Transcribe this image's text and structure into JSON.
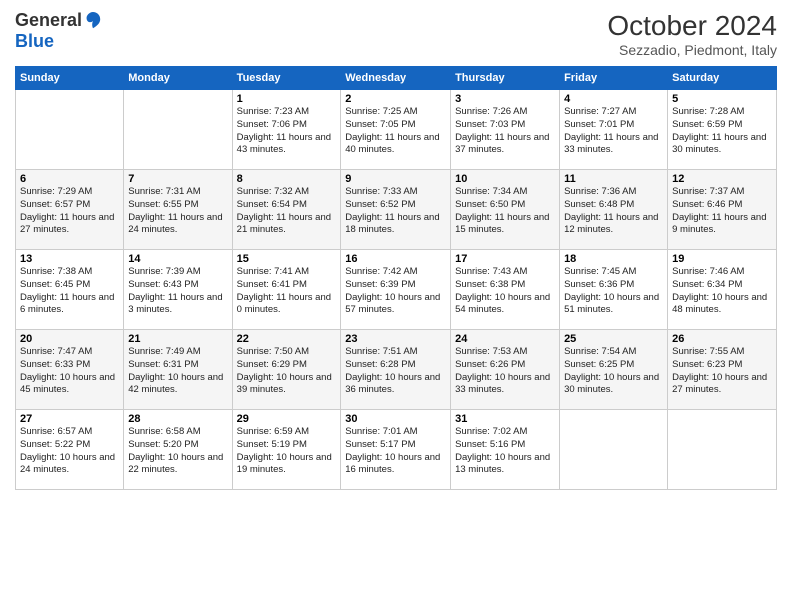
{
  "logo": {
    "general": "General",
    "blue": "Blue"
  },
  "title": "October 2024",
  "subtitle": "Sezzadio, Piedmont, Italy",
  "days_of_week": [
    "Sunday",
    "Monday",
    "Tuesday",
    "Wednesday",
    "Thursday",
    "Friday",
    "Saturday"
  ],
  "weeks": [
    [
      {
        "day": "",
        "sunrise": "",
        "sunset": "",
        "daylight": ""
      },
      {
        "day": "",
        "sunrise": "",
        "sunset": "",
        "daylight": ""
      },
      {
        "day": "1",
        "sunrise": "Sunrise: 7:23 AM",
        "sunset": "Sunset: 7:06 PM",
        "daylight": "Daylight: 11 hours and 43 minutes."
      },
      {
        "day": "2",
        "sunrise": "Sunrise: 7:25 AM",
        "sunset": "Sunset: 7:05 PM",
        "daylight": "Daylight: 11 hours and 40 minutes."
      },
      {
        "day": "3",
        "sunrise": "Sunrise: 7:26 AM",
        "sunset": "Sunset: 7:03 PM",
        "daylight": "Daylight: 11 hours and 37 minutes."
      },
      {
        "day": "4",
        "sunrise": "Sunrise: 7:27 AM",
        "sunset": "Sunset: 7:01 PM",
        "daylight": "Daylight: 11 hours and 33 minutes."
      },
      {
        "day": "5",
        "sunrise": "Sunrise: 7:28 AM",
        "sunset": "Sunset: 6:59 PM",
        "daylight": "Daylight: 11 hours and 30 minutes."
      }
    ],
    [
      {
        "day": "6",
        "sunrise": "Sunrise: 7:29 AM",
        "sunset": "Sunset: 6:57 PM",
        "daylight": "Daylight: 11 hours and 27 minutes."
      },
      {
        "day": "7",
        "sunrise": "Sunrise: 7:31 AM",
        "sunset": "Sunset: 6:55 PM",
        "daylight": "Daylight: 11 hours and 24 minutes."
      },
      {
        "day": "8",
        "sunrise": "Sunrise: 7:32 AM",
        "sunset": "Sunset: 6:54 PM",
        "daylight": "Daylight: 11 hours and 21 minutes."
      },
      {
        "day": "9",
        "sunrise": "Sunrise: 7:33 AM",
        "sunset": "Sunset: 6:52 PM",
        "daylight": "Daylight: 11 hours and 18 minutes."
      },
      {
        "day": "10",
        "sunrise": "Sunrise: 7:34 AM",
        "sunset": "Sunset: 6:50 PM",
        "daylight": "Daylight: 11 hours and 15 minutes."
      },
      {
        "day": "11",
        "sunrise": "Sunrise: 7:36 AM",
        "sunset": "Sunset: 6:48 PM",
        "daylight": "Daylight: 11 hours and 12 minutes."
      },
      {
        "day": "12",
        "sunrise": "Sunrise: 7:37 AM",
        "sunset": "Sunset: 6:46 PM",
        "daylight": "Daylight: 11 hours and 9 minutes."
      }
    ],
    [
      {
        "day": "13",
        "sunrise": "Sunrise: 7:38 AM",
        "sunset": "Sunset: 6:45 PM",
        "daylight": "Daylight: 11 hours and 6 minutes."
      },
      {
        "day": "14",
        "sunrise": "Sunrise: 7:39 AM",
        "sunset": "Sunset: 6:43 PM",
        "daylight": "Daylight: 11 hours and 3 minutes."
      },
      {
        "day": "15",
        "sunrise": "Sunrise: 7:41 AM",
        "sunset": "Sunset: 6:41 PM",
        "daylight": "Daylight: 11 hours and 0 minutes."
      },
      {
        "day": "16",
        "sunrise": "Sunrise: 7:42 AM",
        "sunset": "Sunset: 6:39 PM",
        "daylight": "Daylight: 10 hours and 57 minutes."
      },
      {
        "day": "17",
        "sunrise": "Sunrise: 7:43 AM",
        "sunset": "Sunset: 6:38 PM",
        "daylight": "Daylight: 10 hours and 54 minutes."
      },
      {
        "day": "18",
        "sunrise": "Sunrise: 7:45 AM",
        "sunset": "Sunset: 6:36 PM",
        "daylight": "Daylight: 10 hours and 51 minutes."
      },
      {
        "day": "19",
        "sunrise": "Sunrise: 7:46 AM",
        "sunset": "Sunset: 6:34 PM",
        "daylight": "Daylight: 10 hours and 48 minutes."
      }
    ],
    [
      {
        "day": "20",
        "sunrise": "Sunrise: 7:47 AM",
        "sunset": "Sunset: 6:33 PM",
        "daylight": "Daylight: 10 hours and 45 minutes."
      },
      {
        "day": "21",
        "sunrise": "Sunrise: 7:49 AM",
        "sunset": "Sunset: 6:31 PM",
        "daylight": "Daylight: 10 hours and 42 minutes."
      },
      {
        "day": "22",
        "sunrise": "Sunrise: 7:50 AM",
        "sunset": "Sunset: 6:29 PM",
        "daylight": "Daylight: 10 hours and 39 minutes."
      },
      {
        "day": "23",
        "sunrise": "Sunrise: 7:51 AM",
        "sunset": "Sunset: 6:28 PM",
        "daylight": "Daylight: 10 hours and 36 minutes."
      },
      {
        "day": "24",
        "sunrise": "Sunrise: 7:53 AM",
        "sunset": "Sunset: 6:26 PM",
        "daylight": "Daylight: 10 hours and 33 minutes."
      },
      {
        "day": "25",
        "sunrise": "Sunrise: 7:54 AM",
        "sunset": "Sunset: 6:25 PM",
        "daylight": "Daylight: 10 hours and 30 minutes."
      },
      {
        "day": "26",
        "sunrise": "Sunrise: 7:55 AM",
        "sunset": "Sunset: 6:23 PM",
        "daylight": "Daylight: 10 hours and 27 minutes."
      }
    ],
    [
      {
        "day": "27",
        "sunrise": "Sunrise: 6:57 AM",
        "sunset": "Sunset: 5:22 PM",
        "daylight": "Daylight: 10 hours and 24 minutes."
      },
      {
        "day": "28",
        "sunrise": "Sunrise: 6:58 AM",
        "sunset": "Sunset: 5:20 PM",
        "daylight": "Daylight: 10 hours and 22 minutes."
      },
      {
        "day": "29",
        "sunrise": "Sunrise: 6:59 AM",
        "sunset": "Sunset: 5:19 PM",
        "daylight": "Daylight: 10 hours and 19 minutes."
      },
      {
        "day": "30",
        "sunrise": "Sunrise: 7:01 AM",
        "sunset": "Sunset: 5:17 PM",
        "daylight": "Daylight: 10 hours and 16 minutes."
      },
      {
        "day": "31",
        "sunrise": "Sunrise: 7:02 AM",
        "sunset": "Sunset: 5:16 PM",
        "daylight": "Daylight: 10 hours and 13 minutes."
      },
      {
        "day": "",
        "sunrise": "",
        "sunset": "",
        "daylight": ""
      },
      {
        "day": "",
        "sunrise": "",
        "sunset": "",
        "daylight": ""
      }
    ]
  ]
}
